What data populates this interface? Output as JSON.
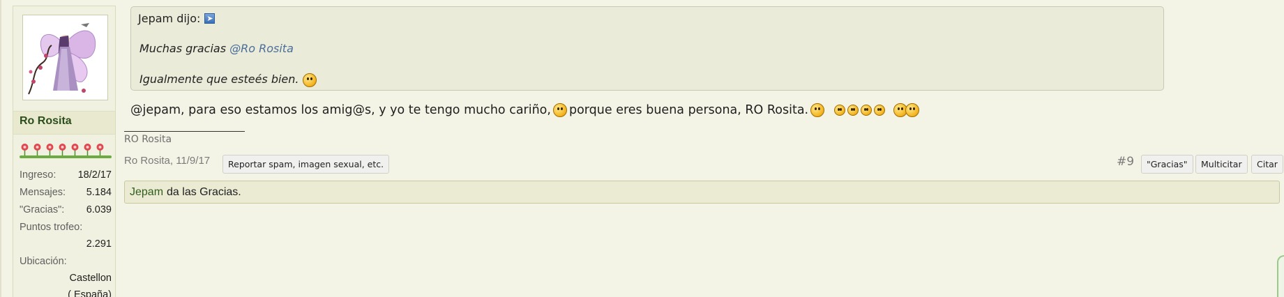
{
  "user": {
    "username": "Ro Rosita",
    "stats": {
      "ingreso_label": "Ingreso:",
      "ingreso_value": "18/2/17",
      "mensajes_label": "Mensajes:",
      "mensajes_value": "5.184",
      "gracias_label": "\"Gracias\":",
      "gracias_value": "6.039",
      "trofeo_label": "Puntos trofeo:",
      "trofeo_value": "2.291",
      "ubicacion_label": "Ubicación:",
      "ubicacion_value_1": "Castellon",
      "ubicacion_value_2": "( España)"
    },
    "rank_flowers": 7
  },
  "quote": {
    "author": "Jepam dijo:",
    "line1": "Muchas gracias ",
    "line1_mention": "@Ro Rosita",
    "line2": "Igualmente que esteés bien."
  },
  "message": {
    "text_part1": "@jepam, para eso estamos los amig@s, y yo te tengo mucho cariño,",
    "text_part2": " porque eres buena persona, RO Rosita. "
  },
  "signature": "RO Rosita",
  "meta": {
    "author_date": "Ro Rosita, 11/9/17",
    "report_label": "Reportar spam, imagen sexual, etc.",
    "post_number": "#9",
    "thanks_label": "\"Gracias\"",
    "multiquote_label": "Multicitar",
    "quote_label": "Citar"
  },
  "likes": {
    "who": "Jepam",
    "text": " da las Gracias."
  },
  "colors": {
    "username": "#2b4d1c",
    "mention": "#4b6f9b",
    "likes_user": "#2f5e1c"
  },
  "icons": [
    "arrow-icon",
    "emoji-icon",
    "flower-icon",
    "avatar-fairy"
  ]
}
